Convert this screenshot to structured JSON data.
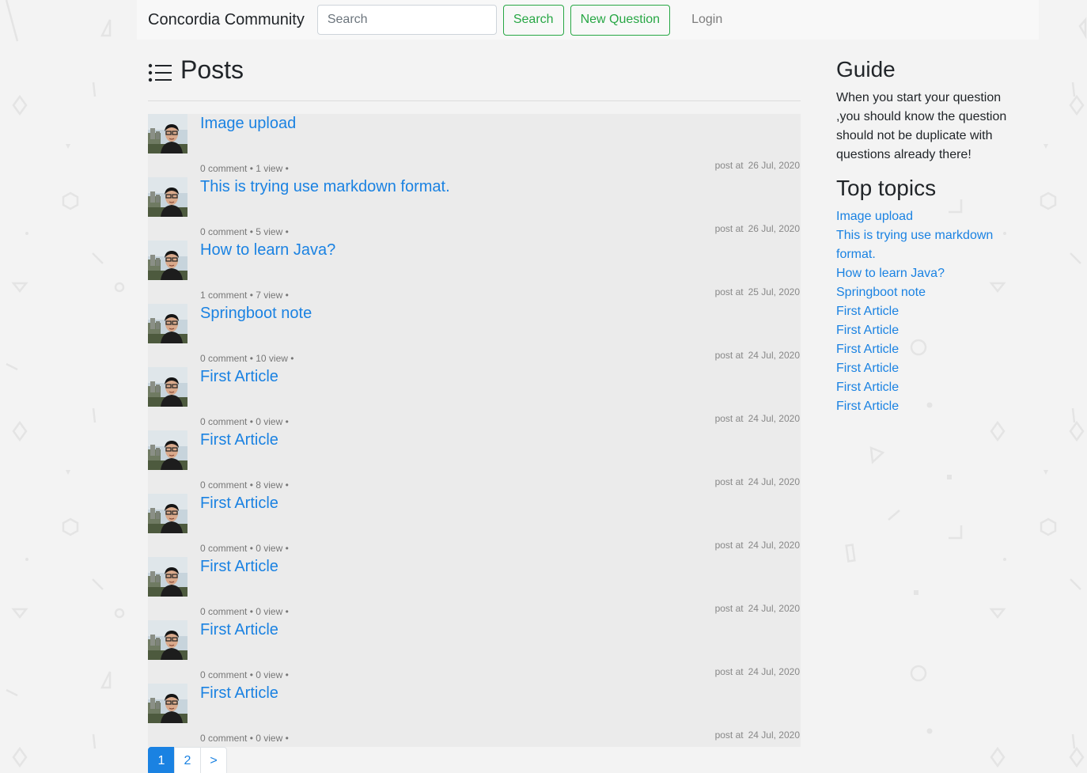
{
  "navbar": {
    "brand": "Concordia Community",
    "search_placeholder": "Search",
    "search_button": "Search",
    "new_question_button": "New Question",
    "login_link": "Login"
  },
  "posts_section": {
    "title": "Posts",
    "posts": [
      {
        "title": "Image upload",
        "comments": "0 comment",
        "views": "1 view",
        "date": "26 Jul, 2020"
      },
      {
        "title": "This is trying use markdown format.",
        "comments": "0 comment",
        "views": "5 view",
        "date": "26 Jul, 2020"
      },
      {
        "title": "How to learn Java?",
        "comments": "1 comment",
        "views": "7 view",
        "date": "25 Jul, 2020"
      },
      {
        "title": "Springboot note",
        "comments": "0 comment",
        "views": "10 view",
        "date": "24 Jul, 2020"
      },
      {
        "title": "First Article",
        "comments": "0 comment",
        "views": "0 view",
        "date": "24 Jul, 2020"
      },
      {
        "title": "First Article",
        "comments": "0 comment",
        "views": "8 view",
        "date": "24 Jul, 2020"
      },
      {
        "title": "First Article",
        "comments": "0 comment",
        "views": "0 view",
        "date": "24 Jul, 2020"
      },
      {
        "title": "First Article",
        "comments": "0 comment",
        "views": "0 view",
        "date": "24 Jul, 2020"
      },
      {
        "title": "First Article",
        "comments": "0 comment",
        "views": "0 view",
        "date": "24 Jul, 2020"
      },
      {
        "title": "First Article",
        "comments": "0 comment",
        "views": "0 view",
        "date": "24 Jul, 2020"
      }
    ],
    "post_at_label": "post at",
    "separator": "•"
  },
  "pagination": {
    "pages": [
      "1",
      "2"
    ],
    "next": ">",
    "current": "1"
  },
  "sidebar": {
    "guide_heading": "Guide",
    "guide_text": "When you start your question ,you should know the question should not be duplicate with questions already there!",
    "topics_heading": "Top topics",
    "topics": [
      "Image upload",
      "This is trying use markdown format.",
      "How to learn Java?",
      "Springboot note",
      "First Article",
      "First Article",
      "First Article",
      "First Article",
      "First Article",
      "First Article"
    ]
  },
  "colors": {
    "link": "#1a82e2",
    "success": "#28a745",
    "post_list_bg": "#ebebeb",
    "navbar_bg": "#f8f8f8"
  }
}
